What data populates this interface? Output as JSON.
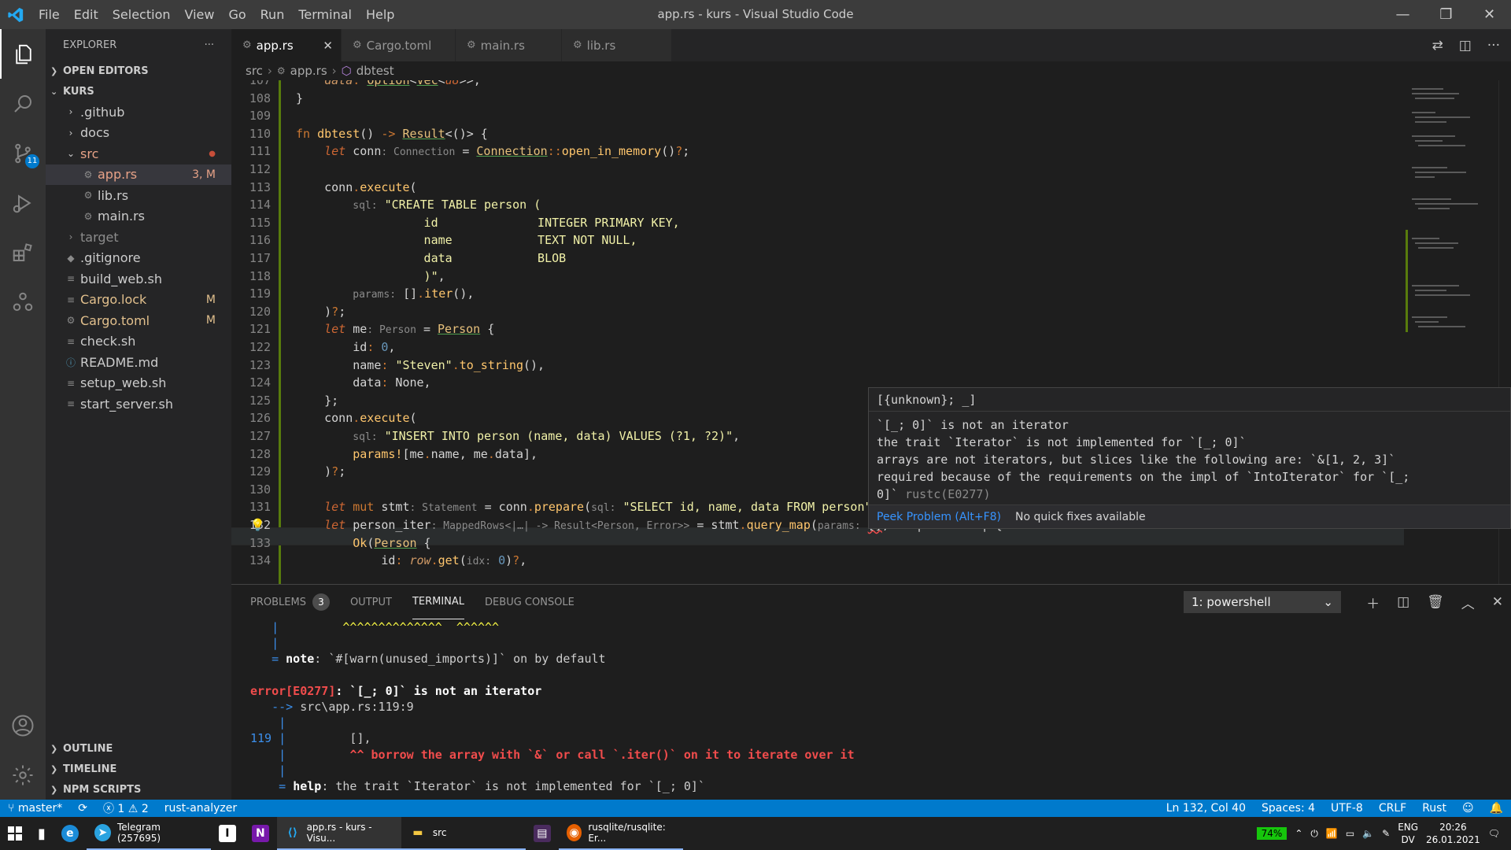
{
  "window": {
    "title": "app.rs - kurs - Visual Studio Code",
    "menu": [
      "File",
      "Edit",
      "Selection",
      "View",
      "Go",
      "Run",
      "Terminal",
      "Help"
    ]
  },
  "activity": {
    "scm_badge": "11"
  },
  "sidebar": {
    "header": "EXPLORER",
    "open_editors": "OPEN EDITORS",
    "root": "KURS",
    "items": [
      {
        "label": ".github",
        "kind": "folder",
        "status": ""
      },
      {
        "label": "docs",
        "kind": "folder",
        "status": ""
      },
      {
        "label": "src",
        "kind": "folder-open",
        "status": "●"
      },
      {
        "label": "app.rs",
        "kind": "file",
        "status": "3, M"
      },
      {
        "label": "lib.rs",
        "kind": "file",
        "status": ""
      },
      {
        "label": "main.rs",
        "kind": "file",
        "status": ""
      },
      {
        "label": "target",
        "kind": "folder",
        "status": ""
      },
      {
        "label": ".gitignore",
        "kind": "file",
        "status": ""
      },
      {
        "label": "build_web.sh",
        "kind": "file",
        "status": ""
      },
      {
        "label": "Cargo.lock",
        "kind": "file",
        "status": "M"
      },
      {
        "label": "Cargo.toml",
        "kind": "file",
        "status": "M"
      },
      {
        "label": "check.sh",
        "kind": "file",
        "status": ""
      },
      {
        "label": "README.md",
        "kind": "file",
        "status": ""
      },
      {
        "label": "setup_web.sh",
        "kind": "file",
        "status": ""
      },
      {
        "label": "start_server.sh",
        "kind": "file",
        "status": ""
      }
    ],
    "outline": "OUTLINE",
    "timeline": "TIMELINE",
    "npm": "NPM SCRIPTS"
  },
  "tabs": [
    {
      "label": "app.rs"
    },
    {
      "label": "Cargo.toml"
    },
    {
      "label": "main.rs"
    },
    {
      "label": "lib.rs"
    }
  ],
  "breadcrumb": [
    "src",
    "app.rs",
    "dbtest"
  ],
  "hover": {
    "header": "[{unknown}; _]",
    "body": "`[_; 0]` is not an iterator\nthe trait `Iterator` is not implemented for `[_; 0]`\narrays are not iterators, but slices like the following are: `&[1, 2, 3]`\nrequired because of the requirements on the impl of `IntoIterator` for `[_;\n0]`",
    "code": "rustc(E0277)",
    "peek": "Peek Problem (Alt+F8)",
    "nofix": "No quick fixes available"
  },
  "panel": {
    "tabs": [
      "PROBLEMS",
      "OUTPUT",
      "TERMINAL",
      "DEBUG CONSOLE"
    ],
    "problems_count": "3",
    "terminal_select": "1: powershell"
  },
  "status": {
    "branch": "master*",
    "errors": "1",
    "warnings": "2",
    "analyzer": "rust-analyzer",
    "position": "Ln 132, Col 40",
    "spaces": "Spaces: 4",
    "encoding": "UTF-8",
    "eol": "CRLF",
    "language": "Rust"
  },
  "taskbar": {
    "telegram": "Telegram (257695)",
    "vscode": "app.rs - kurs - Visu...",
    "explorer": "src",
    "firefox": "rusqlite/rusqlite: Er...",
    "battery": "74%",
    "lang1": "ENG",
    "lang2": "DV",
    "time": "20:26",
    "date": "26.01.2021"
  },
  "colors": {
    "accent": "#007acc",
    "titlebar": "#3c3c3c",
    "editor": "#1e1e1e"
  }
}
